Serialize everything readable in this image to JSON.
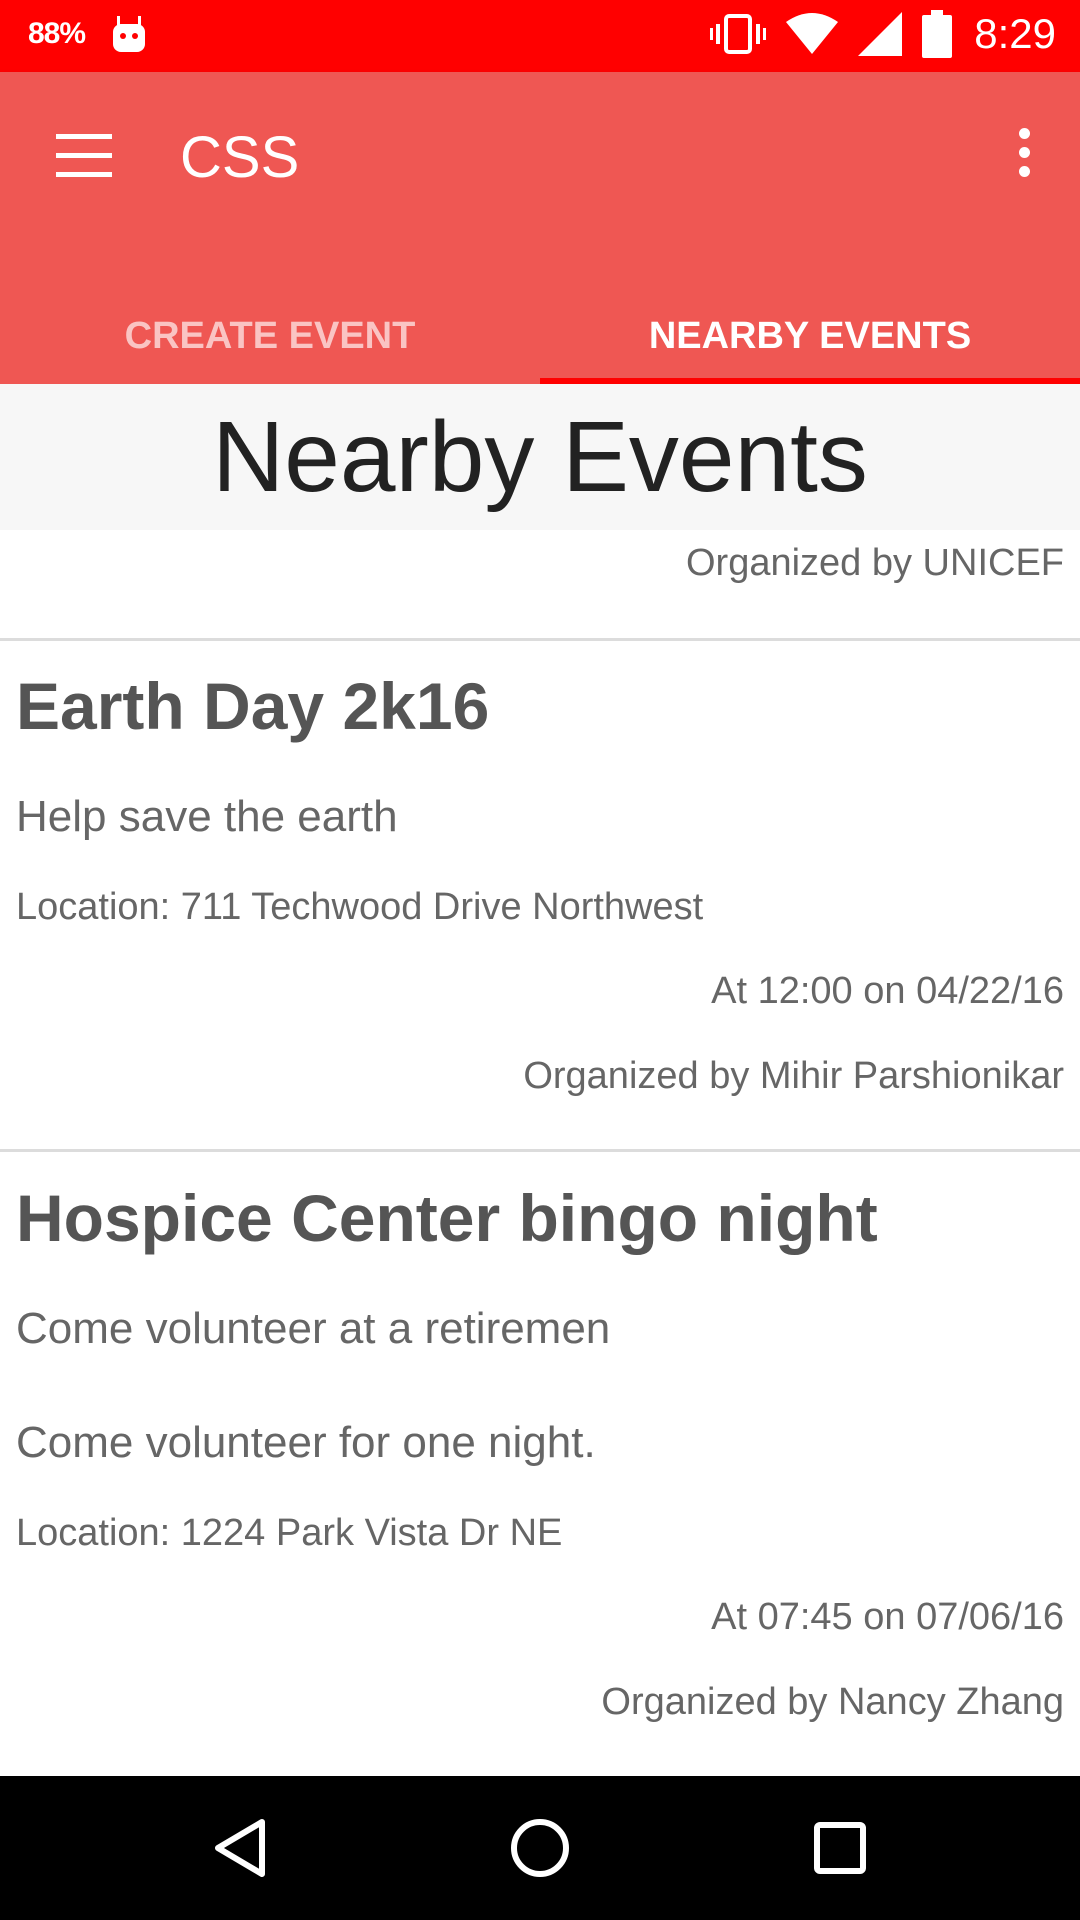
{
  "status_bar": {
    "battery_percent": "88%",
    "time": "8:29",
    "icons": [
      "android-icon",
      "vibrate-icon",
      "wifi-icon",
      "signal-icon",
      "battery-icon"
    ]
  },
  "app_bar": {
    "title": "CSS",
    "tabs": [
      {
        "label": "CREATE EVENT",
        "active": false
      },
      {
        "label": "NEARBY EVENTS",
        "active": true
      }
    ]
  },
  "page": {
    "heading": "Nearby Events",
    "top_organizer": "Organized by UNICEF"
  },
  "events": [
    {
      "title": "Earth Day 2k16",
      "description": "Help save the earth",
      "location": "Location: 711 Techwood Drive Northwest",
      "time": "At 12:00 on 04/22/16",
      "organizer": "Organized by Mihir Parshionikar"
    },
    {
      "title": "Hospice Center bingo night",
      "description": "Come volunteer at a retiremen",
      "description2": "Come volunteer for one night.",
      "location": "Location: 1224 Park Vista Dr NE",
      "time": "At 07:45 on 07/06/16",
      "organizer": "Organized by Nancy Zhang"
    }
  ],
  "colors": {
    "status_bar": "#ff0000",
    "app_bar": "#ef5753",
    "tab_indicator": "#ff0000"
  }
}
